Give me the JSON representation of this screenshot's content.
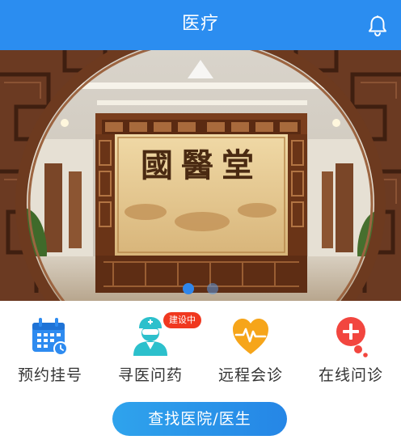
{
  "header": {
    "title": "医疗",
    "bell_icon": "bell-icon",
    "background_color": "#2b8df0"
  },
  "banner": {
    "plaque_text": "國醫堂",
    "slides_total": 2,
    "active_slide": 1
  },
  "features": [
    {
      "label": "预约挂号",
      "icon": "calendar-icon",
      "color": "#2e8bf0"
    },
    {
      "label": "寻医问药",
      "icon": "doctor-icon",
      "color": "#2cc0cc",
      "badge": "建设中"
    },
    {
      "label": "远程会诊",
      "icon": "heart-pulse-icon",
      "color": "#f6a51a"
    },
    {
      "label": "在线问诊",
      "icon": "chat-plus-icon",
      "color": "#f2463f"
    }
  ],
  "search_button": {
    "label": "查找医院/医生",
    "color": "#2a94ea"
  },
  "colors": {
    "badge": "#f0381f",
    "text": "#333333"
  }
}
